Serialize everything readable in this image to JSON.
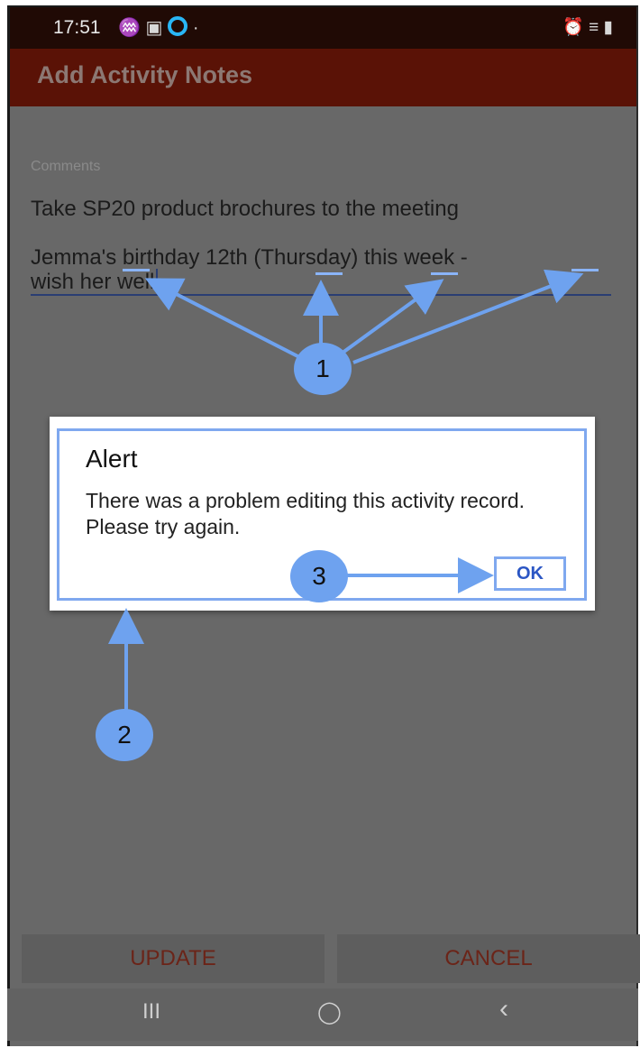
{
  "status_bar": {
    "time": "17:51",
    "left_icons": "♒ ▣",
    "right_icons": "⏰ ≡ ▮"
  },
  "app_bar": {
    "title": "Add Activity Notes"
  },
  "form": {
    "label": "Comments",
    "line1": "Take SP20 product brochures to the meeting",
    "line2": "Jemma's birthday 12th (Thursday) this week -",
    "line3": "wish her well"
  },
  "dialog": {
    "title": "Alert",
    "message": "There was a problem editing this activity record. Please try again.",
    "ok_label": "OK"
  },
  "annotations": {
    "badge1": "1",
    "badge2": "2",
    "badge3": "3"
  },
  "buttons": {
    "update": "UPDATE",
    "cancel": "CANCEL"
  },
  "nav": {
    "recents": "III",
    "home": "◯",
    "back": "‹"
  },
  "colors": {
    "accent": "#6ea2ef",
    "app_bar": "#5a1206",
    "scrim": "#686868"
  }
}
